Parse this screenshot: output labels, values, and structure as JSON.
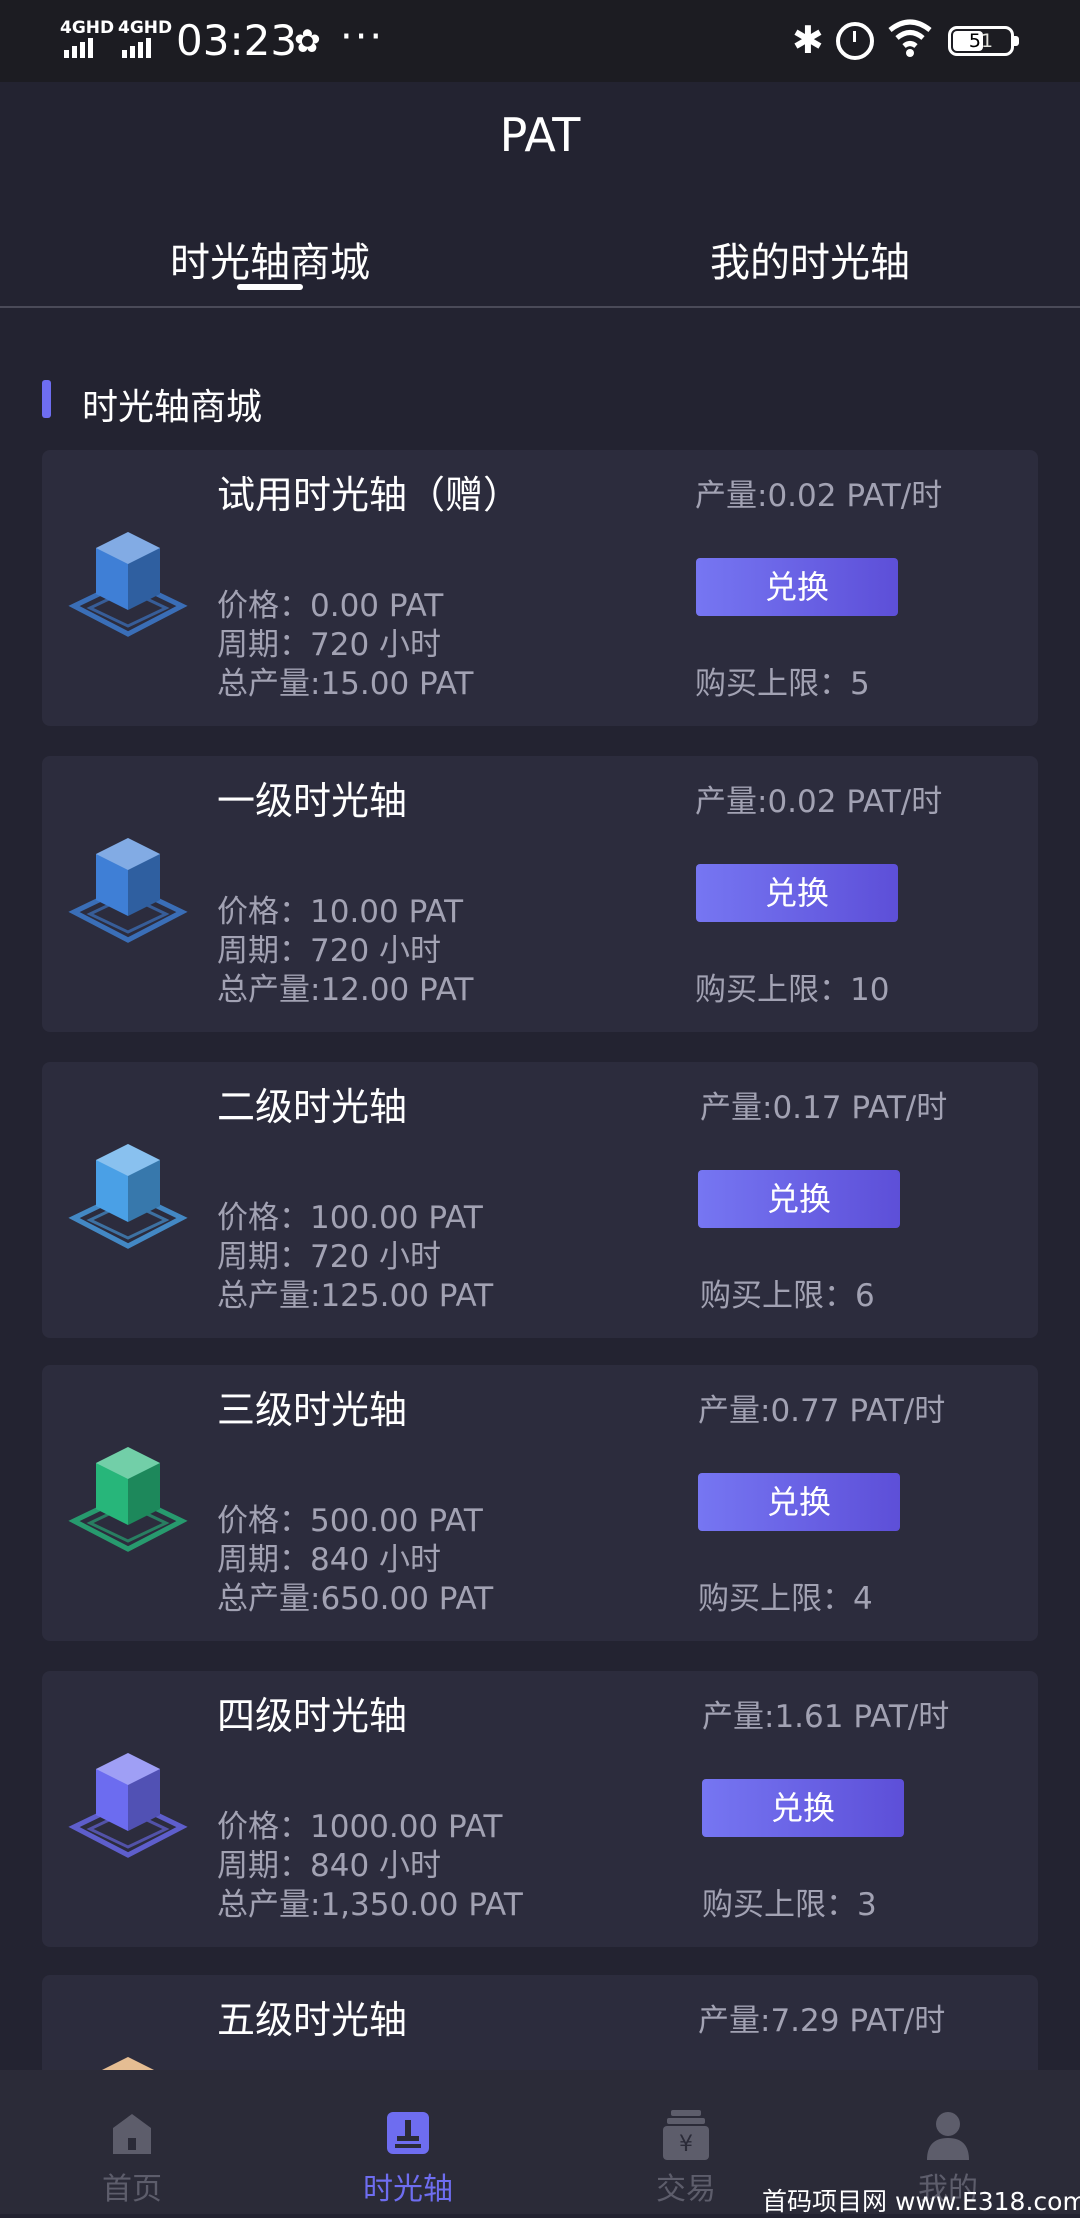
{
  "status_bar": {
    "network_1": "4GHD",
    "network_2": "4GHD",
    "time": "03:23",
    "battery": "51"
  },
  "header": {
    "title": "PAT"
  },
  "tabs": [
    {
      "label": "时光轴商城",
      "active": true
    },
    {
      "label": "我的时光轴",
      "active": false
    }
  ],
  "section": {
    "title": "时光轴商城"
  },
  "cards": [
    {
      "name": "试用时光轴（赠）",
      "price": "价格：0.00 PAT",
      "period": "周期：720 小时",
      "total": "总产量:15.00 PAT",
      "rate": "产量:0.02 PAT/时",
      "button": "兑换",
      "limit": "购买上限：5",
      "icon_color": "#3f7fd6"
    },
    {
      "name": "一级时光轴",
      "price": "价格：10.00 PAT",
      "period": "周期：720 小时",
      "total": "总产量:12.00 PAT",
      "rate": "产量:0.02 PAT/时",
      "button": "兑换",
      "limit": "购买上限：10",
      "icon_color": "#3f7fd6"
    },
    {
      "name": "二级时光轴",
      "price": "价格：100.00 PAT",
      "period": "周期：720 小时",
      "total": "总产量:125.00 PAT",
      "rate": "产量:0.17 PAT/时",
      "button": "兑换",
      "limit": "购买上限：6",
      "icon_color": "#4aa0e6"
    },
    {
      "name": "三级时光轴",
      "price": "价格：500.00 PAT",
      "period": "周期：840 小时",
      "total": "总产量:650.00 PAT",
      "rate": "产量:0.77 PAT/时",
      "button": "兑换",
      "limit": "购买上限：4",
      "icon_color": "#27b67a"
    },
    {
      "name": "四级时光轴",
      "price": "价格：1000.00 PAT",
      "period": "周期：840 小时",
      "total": "总产量:1,350.00 PAT",
      "rate": "产量:1.61 PAT/时",
      "button": "兑换",
      "limit": "购买上限：3",
      "icon_color": "#6c6cf0"
    },
    {
      "name": "五级时光轴",
      "rate": "产量:7.29 PAT/时",
      "icon_color": "#d89a5a"
    }
  ],
  "bottom_nav": [
    {
      "label": "首页",
      "icon": "home-icon",
      "active": false
    },
    {
      "label": "时光轴",
      "icon": "timeline-icon",
      "active": true
    },
    {
      "label": "交易",
      "icon": "trade-icon",
      "active": false
    },
    {
      "label": "我的",
      "icon": "profile-icon",
      "active": false
    }
  ],
  "watermark": "首码项目网  www.E318.com",
  "colors": {
    "background": "#232331",
    "card": "#2c2c3d",
    "accent": "#6e6df0",
    "muted_text": "#a2a2b3"
  }
}
